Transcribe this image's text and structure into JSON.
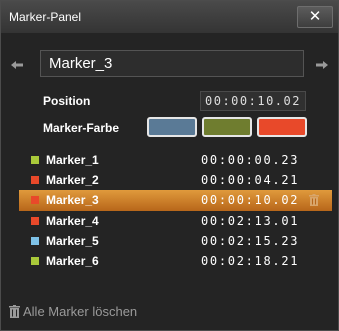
{
  "window": {
    "title": "Marker-Panel",
    "close_label": "✕"
  },
  "selector": {
    "current": "Marker_3"
  },
  "position": {
    "label": "Position",
    "value": "00:00:10.02"
  },
  "color": {
    "label": "Marker-Farbe",
    "swatches": [
      {
        "name": "blue",
        "hex": "#5a7a96"
      },
      {
        "name": "green",
        "hex": "#6f7d2f"
      },
      {
        "name": "red",
        "hex": "#e8492a"
      }
    ]
  },
  "markers": [
    {
      "name": "Marker_1",
      "time": "00:00:00.23",
      "color": "#a9c93a"
    },
    {
      "name": "Marker_2",
      "time": "00:00:04.21",
      "color": "#e8492a"
    },
    {
      "name": "Marker_3",
      "time": "00:00:10.02",
      "color": "#e8492a",
      "selected": true
    },
    {
      "name": "Marker_4",
      "time": "00:02:13.01",
      "color": "#e8492a"
    },
    {
      "name": "Marker_5",
      "time": "00:02:15.23",
      "color": "#7ec2e8"
    },
    {
      "name": "Marker_6",
      "time": "00:02:18.21",
      "color": "#a9c93a"
    }
  ],
  "footer": {
    "clear_all_label": "Alle Marker löschen"
  },
  "icons": {
    "prev": "arrow-left-icon",
    "next": "arrow-right-icon",
    "row_delete": "trash-icon",
    "clear_all": "trash-icon"
  }
}
